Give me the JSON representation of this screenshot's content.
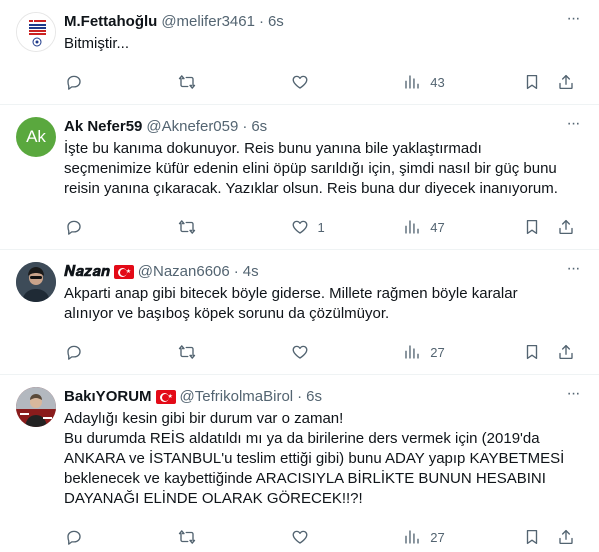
{
  "tweets": [
    {
      "name": "M.Fettahoğlu",
      "handle": "@melifer3461",
      "time": "6s",
      "lines": [
        "Bitmiştir..."
      ],
      "views": "43",
      "replies": "",
      "retweets": "",
      "likes": "",
      "avatar": {
        "type": "image",
        "colors": [
          "#ffffff",
          "#cc2222",
          "#1e3a8a"
        ]
      }
    },
    {
      "name": "Ak Nefer59",
      "handle": "@Aknefer059",
      "time": "6s",
      "lines": [
        "İşte bu kanıma dokunuyor. Reis bunu yanına bile yaklaştırmadı",
        "seçmenimize küfür edenin elini öpüp sarıldığı için, şimdi nasıl bir güç bunu",
        "reisin yanına çıkaracak. Yazıklar olsun. Reis buna dur diyecek inanıyorum."
      ],
      "views": "47",
      "replies": "",
      "retweets": "",
      "likes": "1",
      "avatar": {
        "type": "initials",
        "initials": "Ak",
        "color": "#5aa83e"
      }
    },
    {
      "name": "𝑵𝒂𝒛𝒂𝒏",
      "handle": "@Nazan6606",
      "time": "4s",
      "lines": [
        "Akparti anap gibi bitecek böyle giderse. Millete rağmen böyle karalar",
        "alınıyor ve başıboş köpek sorunu da çözülmüyor."
      ],
      "views": "27",
      "replies": "",
      "retweets": "",
      "likes": "",
      "avatar": {
        "type": "image",
        "colors": [
          "#2b3a4a",
          "#6b7b8a"
        ]
      }
    },
    {
      "name": "BakıYORUM",
      "handle": "@TefrikolmaBirol",
      "time": "6s",
      "lines": [
        "Adaylığı kesin gibi bir durum var o zaman!",
        "Bu durumda REİS aldatıldı mı ya da birilerine ders vermek için (2019'da",
        "ANKARA ve İSTANBUL'u teslim ettiği gibi) bunu ADAY yapıp KAYBETMESİ",
        "beklenecek ve kaybettiğinde ARACISIYLA BİRLİKTE BUNUN HESABINI",
        "DAYANAĞI ELİNDE OLARAK GÖRECEK!!?!"
      ],
      "views": "27",
      "replies": "",
      "retweets": "",
      "likes": "",
      "avatar": {
        "type": "image",
        "colors": [
          "#8a1c1c",
          "#d9d9d9"
        ]
      }
    }
  ],
  "ui": {
    "separator": "·",
    "more_glyph": "···"
  },
  "colors": {
    "text_primary": "#0f1419",
    "text_secondary": "#536471",
    "divider": "#eff3f4",
    "flag_red": "#e30a17"
  }
}
